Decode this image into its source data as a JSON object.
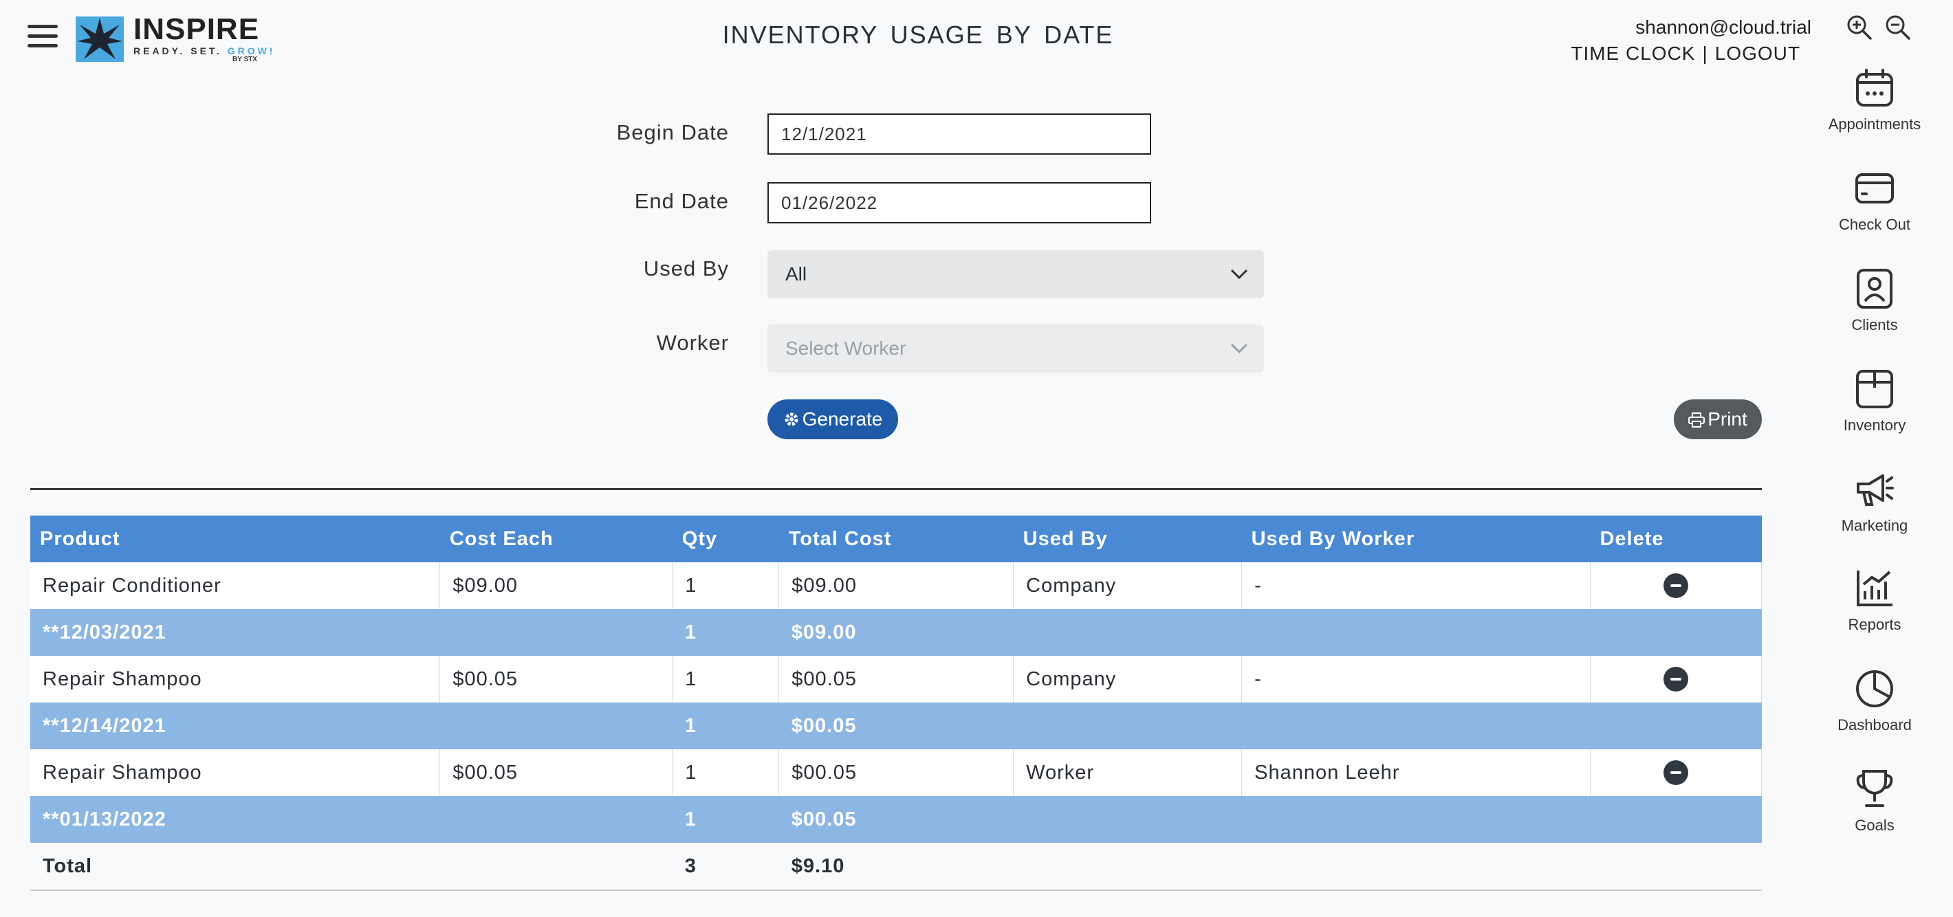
{
  "header": {
    "title": "INVENTORY USAGE BY DATE",
    "logo_word": "INSPIRE",
    "logo_tag_a": "READY. SET. ",
    "logo_tag_b": "GROW!",
    "logo_by": "BY STX",
    "user_email": "shannon@cloud.trial",
    "time_clock": "TIME CLOCK",
    "separator": "|",
    "logout": "LOGOUT"
  },
  "nav": [
    {
      "label": "Appointments",
      "icon": "calendar-icon"
    },
    {
      "label": "Check Out",
      "icon": "credit-card-icon"
    },
    {
      "label": "Clients",
      "icon": "person-icon"
    },
    {
      "label": "Inventory",
      "icon": "box-icon"
    },
    {
      "label": "Marketing",
      "icon": "megaphone-icon"
    },
    {
      "label": "Reports",
      "icon": "bar-chart-icon"
    },
    {
      "label": "Dashboard",
      "icon": "pie-chart-icon"
    },
    {
      "label": "Goals",
      "icon": "trophy-icon"
    }
  ],
  "form": {
    "begin_label": "Begin Date",
    "begin_value": "12/1/2021",
    "end_label": "End Date",
    "end_value": "01/26/2022",
    "used_by_label": "Used By",
    "used_by_value": "All",
    "worker_label": "Worker",
    "worker_placeholder": "Select Worker",
    "generate": "Generate",
    "print": "Print"
  },
  "table": {
    "headers": [
      "Product",
      "Cost Each",
      "Qty",
      "Total Cost",
      "Used By",
      "Used By Worker",
      "Delete"
    ],
    "rows": [
      {
        "product": "Repair Conditioner",
        "cost": "$09.00",
        "qty": "1",
        "total": "$09.00",
        "used_by": "Company",
        "worker": "-"
      },
      {
        "product": "Repair Shampoo",
        "cost": "$00.05",
        "qty": "1",
        "total": "$00.05",
        "used_by": "Company",
        "worker": "-"
      },
      {
        "product": "Repair Shampoo",
        "cost": "$00.05",
        "qty": "1",
        "total": "$00.05",
        "used_by": "Worker",
        "worker": "Shannon Leehr"
      }
    ],
    "subtotals": [
      {
        "date": "**12/03/2021",
        "qty": "1",
        "total": "$09.00"
      },
      {
        "date": "**12/14/2021",
        "qty": "1",
        "total": "$00.05"
      },
      {
        "date": "**01/13/2022",
        "qty": "1",
        "total": "$00.05"
      }
    ],
    "total": {
      "label": "Total",
      "qty": "3",
      "total": "$9.10"
    }
  },
  "colors": {
    "header_blue": "#4a89d4",
    "subtotal_blue": "#8cb6e3",
    "generate_blue": "#1f5aa8",
    "print_gray": "#555a5f"
  }
}
